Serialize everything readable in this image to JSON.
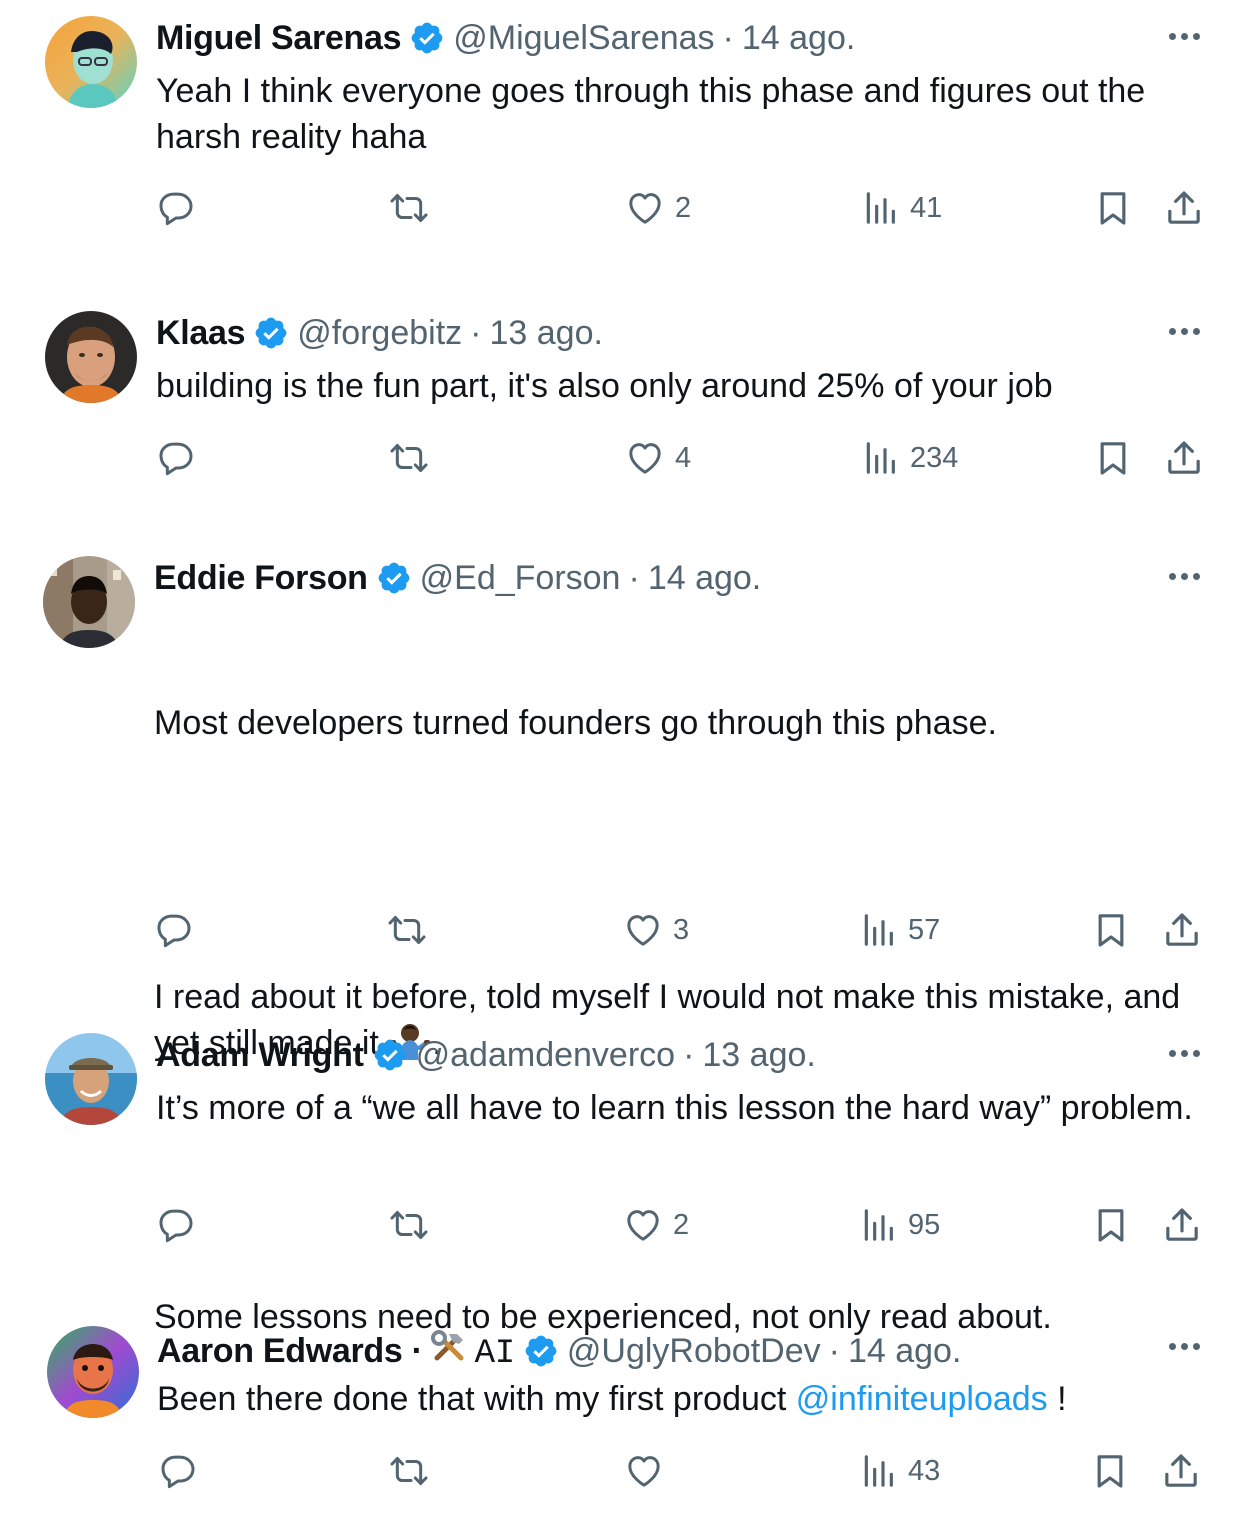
{
  "colors": {
    "text": "#0f1419",
    "muted": "#536471",
    "accent": "#1d9bf0",
    "background": "#ffffff"
  },
  "icons": [
    "reply-icon",
    "retweet-icon",
    "like-icon",
    "views-icon",
    "bookmark-icon",
    "share-icon",
    "more-icon",
    "verified-badge-icon"
  ],
  "tweets": [
    {
      "name": "Miguel Sarenas",
      "handle": "@MiguelSarenas",
      "separator": "·",
      "time": "14 ago.",
      "text": "Yeah I think everyone goes through this phase and figures out the harsh reality haha",
      "likes": "2",
      "views": "41"
    },
    {
      "name": "Klaas",
      "handle": "@forgebitz",
      "separator": "·",
      "time": "13 ago.",
      "text": "building is the fun part, it's also only around 25% of your job",
      "likes": "4",
      "views": "234"
    },
    {
      "name": "Eddie Forson",
      "handle": "@Ed_Forson",
      "separator": "·",
      "time": "14 ago.",
      "text_p1": "Most developers turned founders go through this phase.",
      "text_p2": "I read about it before, told myself I would not make this mistake, and yet still made it",
      "text_p2_end": ".",
      "text_p3": "Some lessons need to be experienced, not only read about.",
      "likes": "3",
      "views": "57"
    },
    {
      "name": "Adam Wright",
      "handle": "@adamdenverco",
      "separator": "·",
      "time": "13 ago.",
      "text": "It’s more of a “we all have to learn this lesson the hard way” problem.",
      "likes": "2",
      "views": "95"
    },
    {
      "name": "Aaron Edwards",
      "name_separator": " ·",
      "name_suffix": "AI",
      "handle": "@UglyRobotDev",
      "separator": "·",
      "time": "14 ago.",
      "text": "Been there done that with my first product ",
      "mention": "@infiniteuploads",
      "text_end": " !",
      "likes": "",
      "views": "43"
    }
  ]
}
